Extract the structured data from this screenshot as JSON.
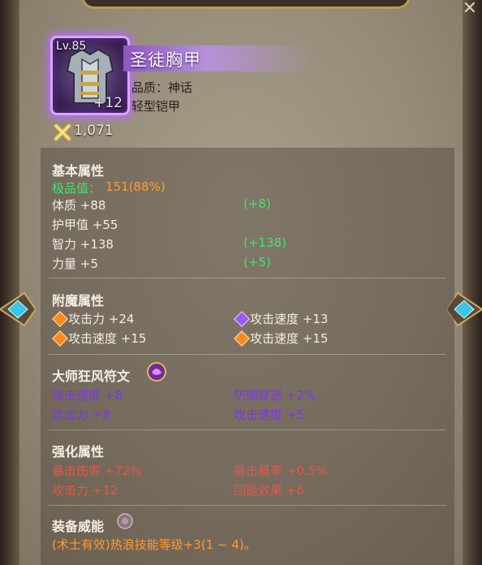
{
  "item": {
    "level": "Lv.85",
    "enhance": "+12",
    "name": "圣徒胸甲",
    "quality": "品质：神话",
    "type": "轻型铠甲",
    "sell_price": "1,071"
  },
  "base": {
    "title": "基本属性",
    "grade_label": "极品值：",
    "grade_value": "151(88%)",
    "stats": [
      {
        "label": "体质 +88",
        "bonus": "(+8)"
      },
      {
        "label": "护甲值 +55",
        "bonus": ""
      },
      {
        "label": "智力 +138",
        "bonus": "(+138)"
      },
      {
        "label": "力量 +5",
        "bonus": "(+5)"
      }
    ]
  },
  "enchant": {
    "title": "附魔属性",
    "items": [
      {
        "label": "攻击力 +24",
        "gem": "orange-gem-icon"
      },
      {
        "label": "攻击速度 +13",
        "gem": "purple-gem-icon"
      },
      {
        "label": "攻击速度 +15",
        "gem": "orange-gem-icon"
      },
      {
        "label": "攻击速度 +15",
        "gem": "orange-gem-icon"
      }
    ]
  },
  "rune": {
    "title": "大师狂风符文",
    "items": [
      "攻击速度 +8",
      "防御穿透 +2%",
      "攻击力 +8",
      "攻击速度 +5"
    ]
  },
  "enhance": {
    "title": "强化属性",
    "items": [
      "暴击伤害 +72%",
      "暴击概率 +0.5%",
      "攻击力 +12",
      "回能效果 +6"
    ]
  },
  "power": {
    "title": "装备威能",
    "text": "(术士有效)热浪技能等级+3(1 ~ 4)。"
  },
  "colors": {
    "green": "#3fe66b",
    "orange": "#ff9a2e",
    "purple": "#7a38e0",
    "red": "#e0584b",
    "mythic": "#b56cff"
  }
}
